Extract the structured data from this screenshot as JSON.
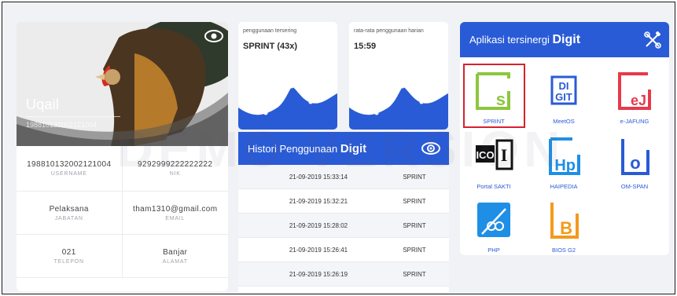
{
  "profile": {
    "name": "Uqail",
    "id": "198810132002121004",
    "fields": [
      [
        {
          "value": "198810132002121004",
          "label": "USERNAME"
        },
        {
          "value": "9292999222222222",
          "label": "NIK"
        }
      ],
      [
        {
          "value": "Pelaksana",
          "label": "JABATAN"
        },
        {
          "value": "tham1310@gmail.com",
          "label": "EMAIL"
        }
      ],
      [
        {
          "value": "021",
          "label": "TELEPON"
        },
        {
          "value": "Banjar",
          "label": "ALAMAT"
        }
      ]
    ]
  },
  "stats": [
    {
      "label": "penggunaan tersering",
      "value": "SPRINT (43x)"
    },
    {
      "label": "rata-rata penggunaan harian",
      "value": "15:59"
    }
  ],
  "history": {
    "title": "Histori Penggunaan",
    "brand": "Digit",
    "rows": [
      {
        "datetime": "21-09-2019 15:33:14",
        "app": "SPRINT"
      },
      {
        "datetime": "21-09-2019 15:32:21",
        "app": "SPRINT"
      },
      {
        "datetime": "21-09-2019 15:28:02",
        "app": "SPRINT"
      },
      {
        "datetime": "21-09-2019 15:26:41",
        "app": "SPRINT"
      },
      {
        "datetime": "21-09-2019 15:26:19",
        "app": "SPRINT"
      }
    ]
  },
  "apps": {
    "title": "Aplikasi tersinergi",
    "brand": "Digit",
    "items": [
      {
        "label": "SPRINT",
        "letter": "s",
        "color": "#8cc63f",
        "icon": "sprint-icon"
      },
      {
        "label": "MeetOS",
        "letter": "DI GIT",
        "color": "#2a5bd6",
        "icon": "meetos-icon"
      },
      {
        "label": "e-JAFUNG",
        "letter": "eJ",
        "color": "#e8394a",
        "icon": "ejafung-icon"
      },
      {
        "label": "Portal SAKTI",
        "letter": "ICO I",
        "color": "#111111",
        "icon": "portal-sakti-icon"
      },
      {
        "label": "HAIPEDIA",
        "letter": "Hp",
        "color": "#1f8fe5",
        "icon": "haipedia-icon"
      },
      {
        "label": "OM-SPAN",
        "letter": "o",
        "color": "#2a5bd6",
        "icon": "om-span-icon"
      },
      {
        "label": "PHP",
        "letter": "",
        "color": "#1f8fe5",
        "icon": "php-icon"
      },
      {
        "label": "BIOS G2",
        "letter": "B",
        "color": "#f39a1b",
        "icon": "bios-g2-icon"
      }
    ]
  },
  "watermark": "DEMO VERSION",
  "colors": {
    "primary": "#2a5bd6",
    "background": "#f1f2f6",
    "selected": "#d6222e"
  }
}
